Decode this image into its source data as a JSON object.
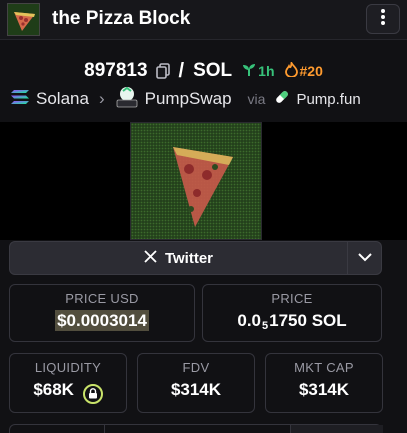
{
  "header": {
    "title": "the Pizza Block",
    "menu_icon": "kebab-menu-icon"
  },
  "pair": {
    "address": "897813",
    "separator": "/",
    "quote": "SOL",
    "age": "1h",
    "rank": "#20",
    "colors": {
      "age": "#37c27a",
      "rank": "#ff9b2f"
    }
  },
  "chain": {
    "network": "Solana",
    "dex": "PumpSwap",
    "via_label": "via",
    "launchpad": "Pump.fun"
  },
  "social": {
    "twitter_label": "Twitter"
  },
  "stats": {
    "price_usd": {
      "label": "PRICE USD",
      "value": "$0.0003014"
    },
    "price_native": {
      "label": "PRICE",
      "prefix": "0.0",
      "zeros": "5",
      "digits": "1750",
      "unit": "SOL"
    },
    "liquidity": {
      "label": "LIQUIDITY",
      "value": "$68K"
    },
    "fdv": {
      "label": "FDV",
      "value": "$314K"
    },
    "mkt_cap": {
      "label": "MKT CAP",
      "value": "$314K"
    }
  }
}
